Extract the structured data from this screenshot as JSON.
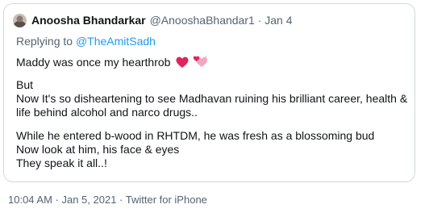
{
  "tweet": {
    "display_name": "Anoosha Bhandarkar",
    "handle_and_date": "@AnooshaBhandar1 · Jan 4",
    "replying_prefix": "Replying to",
    "replying_mention": "@TheAmitSadh",
    "line1": "Maddy was once my hearthrob",
    "emoji": "heart-icon, hearts-icon",
    "line2": "But",
    "line3": "Now It's so disheartening to see Madhavan ruining his brilliant career, health &",
    "line4": "life behind alcohol and narco drugs..",
    "line5": "While he entered b-wood in RHTDM, he was fresh as a blossoming bud",
    "line6": "Now look at him, his face & eyes",
    "line7": "They speak it all..!"
  },
  "footer": {
    "meta": "10:04 AM · Jan 5, 2021 · Twitter for iPhone"
  },
  "colors": {
    "text": "#0f1419",
    "secondary": "#536471",
    "link": "#1d9bf0",
    "heart": "#e0245e",
    "border": "#cfd9de"
  }
}
